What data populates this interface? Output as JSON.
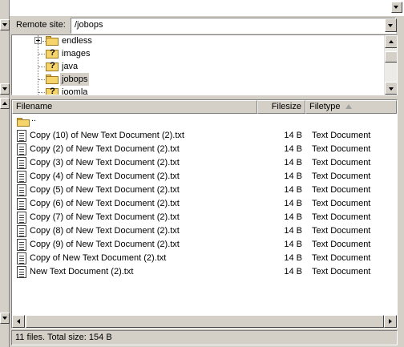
{
  "remote": {
    "label": "Remote site:",
    "path": "/jobops"
  },
  "tree": {
    "items": [
      {
        "label": "endless",
        "icon": "folder-icon",
        "expandable": true,
        "selected": false
      },
      {
        "label": "images",
        "icon": "folder-question-icon",
        "expandable": false,
        "selected": false
      },
      {
        "label": "java",
        "icon": "folder-question-icon",
        "expandable": false,
        "selected": false
      },
      {
        "label": "jobops",
        "icon": "folder-icon",
        "expandable": false,
        "selected": true
      },
      {
        "label": "joomla",
        "icon": "folder-question-icon",
        "expandable": false,
        "selected": false
      }
    ]
  },
  "list": {
    "columns": {
      "filename": "Filename",
      "filesize": "Filesize",
      "filetype": "Filetype"
    },
    "parent": "..",
    "files": [
      {
        "name": "Copy (10) of New Text Document (2).txt",
        "size": "14 B",
        "type": "Text Document"
      },
      {
        "name": "Copy (2) of New Text Document (2).txt",
        "size": "14 B",
        "type": "Text Document"
      },
      {
        "name": "Copy (3) of New Text Document (2).txt",
        "size": "14 B",
        "type": "Text Document"
      },
      {
        "name": "Copy (4) of New Text Document (2).txt",
        "size": "14 B",
        "type": "Text Document"
      },
      {
        "name": "Copy (5) of New Text Document (2).txt",
        "size": "14 B",
        "type": "Text Document"
      },
      {
        "name": "Copy (6) of New Text Document (2).txt",
        "size": "14 B",
        "type": "Text Document"
      },
      {
        "name": "Copy (7) of New Text Document (2).txt",
        "size": "14 B",
        "type": "Text Document"
      },
      {
        "name": "Copy (8) of New Text Document (2).txt",
        "size": "14 B",
        "type": "Text Document"
      },
      {
        "name": "Copy (9) of New Text Document (2).txt",
        "size": "14 B",
        "type": "Text Document"
      },
      {
        "name": "Copy of New Text Document (2).txt",
        "size": "14 B",
        "type": "Text Document"
      },
      {
        "name": "New Text Document (2).txt",
        "size": "14 B",
        "type": "Text Document"
      }
    ]
  },
  "status": {
    "text": "11 files. Total size: 154 B"
  },
  "colors": {
    "chrome": "#d4d0c8",
    "pane_bg": "#ffffff",
    "folder": "#f5d56b"
  }
}
